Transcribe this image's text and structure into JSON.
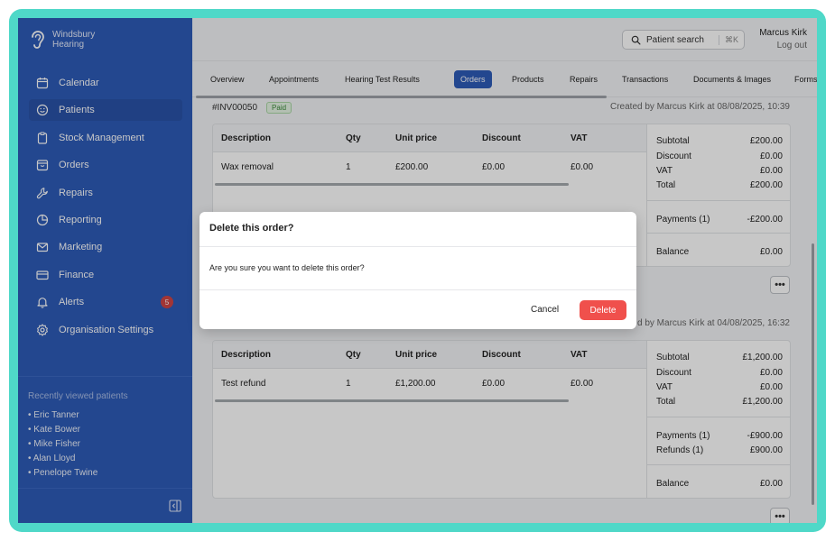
{
  "brand": {
    "name_line1": "Windsbury",
    "name_line2": "Hearing"
  },
  "sidebar": {
    "items": [
      {
        "label": "Calendar",
        "icon": "calendar-icon"
      },
      {
        "label": "Patients",
        "icon": "smiley-icon",
        "active": true
      },
      {
        "label": "Stock Management",
        "icon": "clipboard-icon"
      },
      {
        "label": "Orders",
        "icon": "box-icon"
      },
      {
        "label": "Repairs",
        "icon": "wrench-icon"
      },
      {
        "label": "Reporting",
        "icon": "pie-chart-icon"
      },
      {
        "label": "Marketing",
        "icon": "envelope-icon"
      },
      {
        "label": "Finance",
        "icon": "credit-card-icon"
      },
      {
        "label": "Alerts",
        "icon": "bell-icon",
        "badge": "5"
      },
      {
        "label": "Organisation Settings",
        "icon": "gear-icon"
      }
    ],
    "recent_title": "Recently viewed patients",
    "recent": [
      "• Eric Tanner",
      "• Kate Bower",
      "• Mike Fisher",
      "• Alan Lloyd",
      "• Penelope Twine"
    ]
  },
  "header": {
    "search_label": "Patient search",
    "search_shortcut": "⌘K",
    "user_name": "Marcus Kirk",
    "logout": "Log out"
  },
  "tabs": [
    "Overview",
    "Appointments",
    "Hearing Test Results",
    "Orders",
    "Products",
    "Repairs",
    "Transactions",
    "Documents & Images",
    "Forms"
  ],
  "active_tab": "Orders",
  "columns": {
    "description": "Description",
    "qty": "Qty",
    "unit_price": "Unit price",
    "discount": "Discount",
    "vat": "VAT"
  },
  "orders": [
    {
      "number": "#INV00050",
      "status": "Paid",
      "created": "Created by Marcus Kirk at 08/08/2025, 10:39",
      "line": {
        "description": "Wax removal",
        "qty": "1",
        "unit_price": "£200.00",
        "discount": "£0.00",
        "vat": "£0.00"
      },
      "totals": {
        "subtotal_label": "Subtotal",
        "subtotal": "£200.00",
        "discount_label": "Discount",
        "discount": "£0.00",
        "vat_label": "VAT",
        "vat": "£0.00",
        "total_label": "Total",
        "total": "£200.00",
        "payments_label": "Payments (1)",
        "payments": "-£200.00",
        "balance_label": "Balance",
        "balance": "£0.00"
      }
    },
    {
      "created": "d by Marcus Kirk at 04/08/2025, 16:32",
      "line": {
        "description": "Test refund",
        "qty": "1",
        "unit_price": "£1,200.00",
        "discount": "£0.00",
        "vat": "£0.00"
      },
      "totals": {
        "subtotal_label": "Subtotal",
        "subtotal": "£1,200.00",
        "discount_label": "Discount",
        "discount": "£0.00",
        "vat_label": "VAT",
        "vat": "£0.00",
        "total_label": "Total",
        "total": "£1,200.00",
        "payments_label": "Payments (1)",
        "payments": "-£900.00",
        "refunds_label": "Refunds (1)",
        "refunds": "£900.00",
        "balance_label": "Balance",
        "balance": "£0.00"
      }
    }
  ],
  "more_label": "•••",
  "modal": {
    "title": "Delete this order?",
    "body": "Are you sure you want to delete this order?",
    "cancel": "Cancel",
    "delete": "Delete"
  },
  "colors": {
    "sidebar": "#2e5bb8",
    "accent": "#2e5bb8",
    "danger": "#f0504c",
    "frame": "#4fd8c8"
  }
}
